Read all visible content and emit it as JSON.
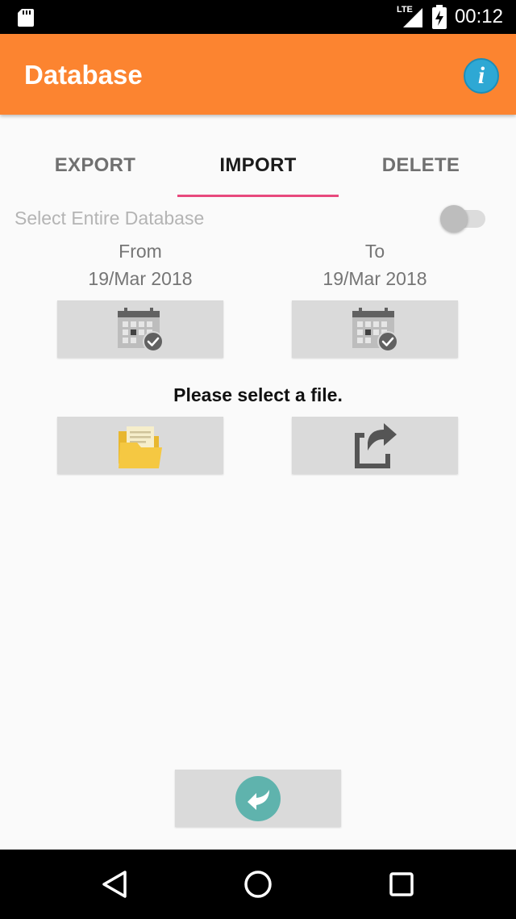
{
  "status_bar": {
    "network": "LTE",
    "time": "00:12",
    "icons": [
      "sd-card-icon",
      "signal-icon",
      "battery-charging-icon"
    ]
  },
  "app_bar": {
    "title": "Database",
    "info_icon": "info-icon",
    "info_glyph": "i",
    "color": "#fc8430"
  },
  "tabs": [
    {
      "label": "EXPORT",
      "active": false
    },
    {
      "label": "IMPORT",
      "active": true
    },
    {
      "label": "DELETE",
      "active": false
    }
  ],
  "tab_indicator_color": "#e8497d",
  "select_entire": {
    "label": "Select Entire Database",
    "checked": false
  },
  "from": {
    "label": "From",
    "date": "19/Mar 2018",
    "button_icon": "calendar-check-icon"
  },
  "to": {
    "label": "To",
    "date": "19/Mar 2018",
    "button_icon": "calendar-check-icon"
  },
  "file": {
    "prompt": "Please select a file.",
    "browse_icon": "folder-icon",
    "import_icon": "import-arrow-icon"
  },
  "back_button": {
    "icon": "back-arrow-icon",
    "color": "#5fb3ad"
  },
  "nav_bar": {
    "items": [
      "back-triangle-icon",
      "home-circle-icon",
      "recents-square-icon"
    ]
  }
}
